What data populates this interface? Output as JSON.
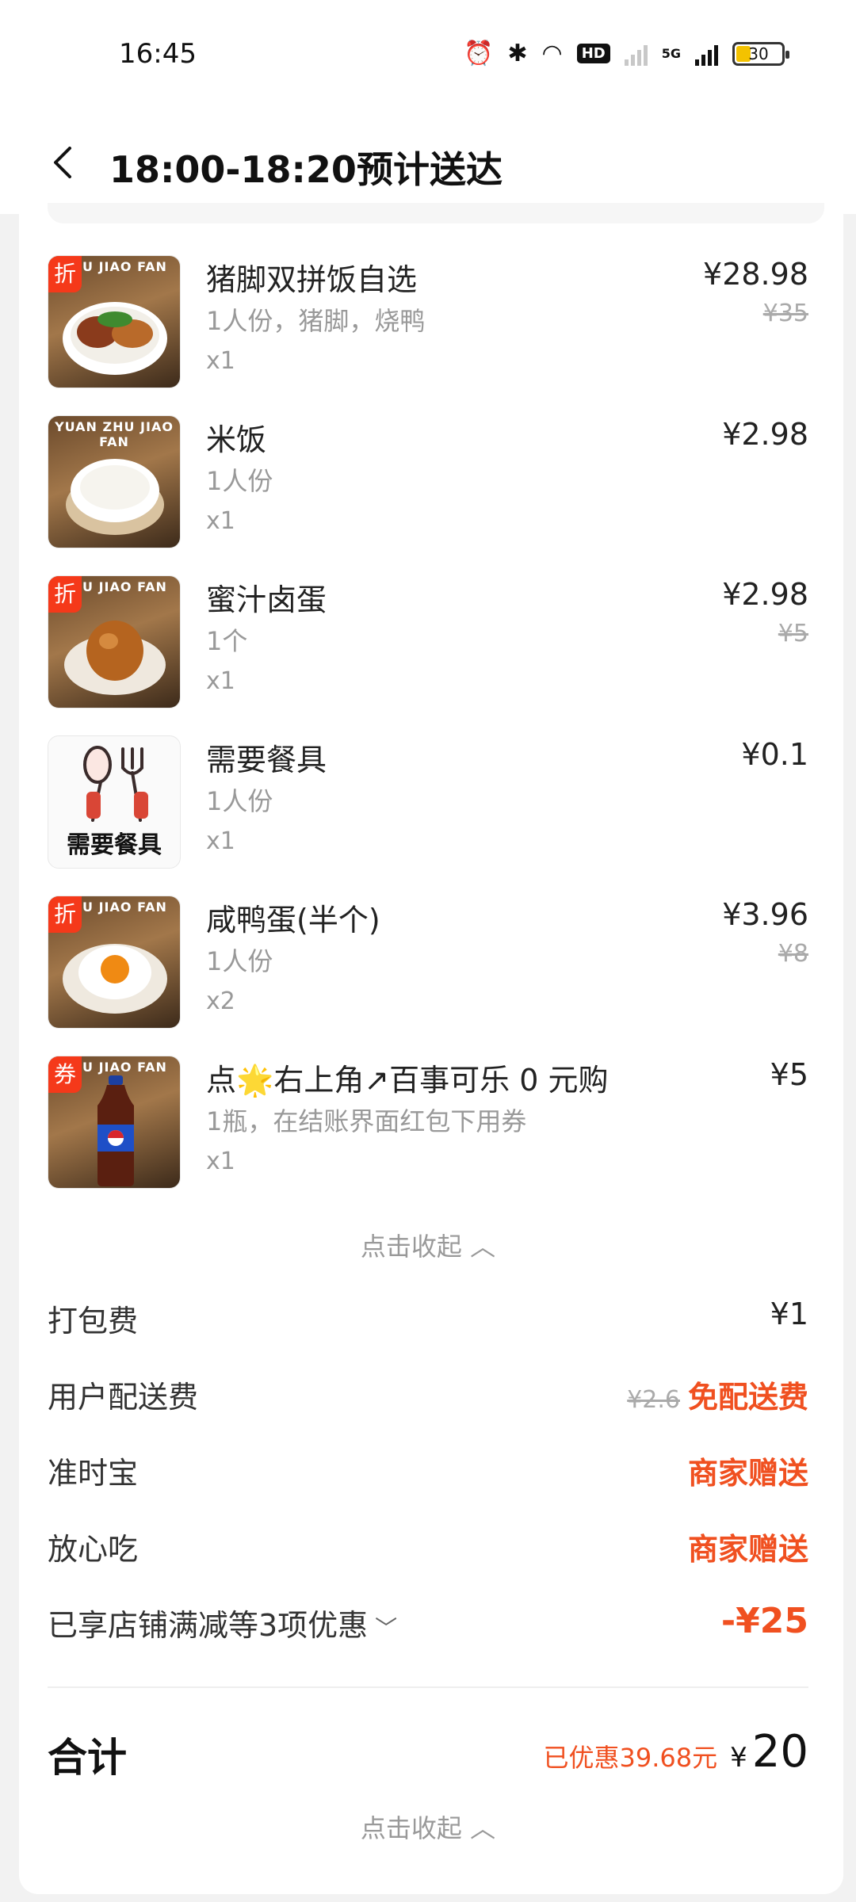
{
  "status_bar": {
    "time": "16:45",
    "hd_chip": "HD",
    "network": "5G",
    "battery": "30"
  },
  "nav": {
    "title": "18:00-18:20预计送达"
  },
  "items": [
    {
      "tag": "折",
      "brand": "ZHU JIAO FAN",
      "name": "猪脚双拼饭自选",
      "spec": "1人份，猪脚，烧鸭",
      "qty": "x1",
      "price": "¥28.98",
      "orig": "¥35"
    },
    {
      "tag": "",
      "brand": "YUAN ZHU JIAO FAN",
      "name": "米饭",
      "spec": "1人份",
      "qty": "x1",
      "price": "¥2.98",
      "orig": ""
    },
    {
      "tag": "折",
      "brand": "ZHU JIAO FAN",
      "name": "蜜汁卤蛋",
      "spec": "1个",
      "qty": "x1",
      "price": "¥2.98",
      "orig": "¥5"
    },
    {
      "tag": "",
      "brand": "",
      "name": "需要餐具",
      "spec": "1人份",
      "qty": "x1",
      "price": "¥0.1",
      "orig": "",
      "thumb_text": "需要餐具"
    },
    {
      "tag": "折",
      "brand": "ZHU JIAO FAN",
      "name": "咸鸭蛋(半个)",
      "spec": "1人份",
      "qty": "x2",
      "price": "¥3.96",
      "orig": "¥8"
    },
    {
      "tag": "券",
      "brand": "ZHU JIAO FAN",
      "name": "点🌟右上角↗百事可乐 0 元购",
      "spec": "1瓶，在结账界面红包下用券",
      "qty": "x1",
      "price": "¥5",
      "orig": ""
    }
  ],
  "collapse_label": "点击收起",
  "fees": {
    "packing": {
      "label": "打包费",
      "value": "¥1"
    },
    "delivery": {
      "label": "用户配送费",
      "orig": "¥2.6",
      "value": "免配送费"
    },
    "ontime": {
      "label": "准时宝",
      "value": "商家赠送"
    },
    "safe": {
      "label": "放心吃",
      "value": "商家赠送"
    },
    "discount": {
      "label": "已享店铺满减等3项优惠",
      "value": "-¥25"
    }
  },
  "total": {
    "label": "合计",
    "saved": "已优惠39.68元",
    "currency": "¥",
    "amount": "20"
  },
  "colors": {
    "accent_red": "#f05020",
    "tag_red": "#f5391a"
  }
}
